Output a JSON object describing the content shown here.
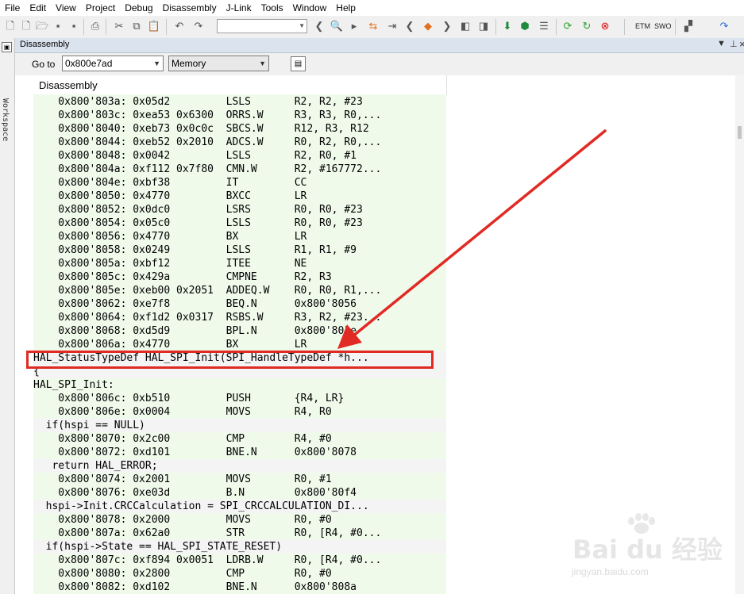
{
  "menu": [
    "File",
    "Edit",
    "View",
    "Project",
    "Debug",
    "Disassembly",
    "J-Link",
    "Tools",
    "Window",
    "Help"
  ],
  "toolbar": {
    "etm_label": "ETM",
    "swo_label": "SWO"
  },
  "workspace_tab": "Workspace",
  "pane": {
    "title": "Disassembly",
    "pin_glyph": "▼",
    "dock_glyph": "⊥",
    "close_glyph": "×"
  },
  "goto": {
    "label": "Go to",
    "address": "0x800e7ad",
    "memory": "Memory"
  },
  "listing": {
    "column_header": "Disassembly",
    "lines": [
      {
        "text": "    0x800'803a: 0x05d2         LSLS       R2, R2, #23",
        "kind": "asm"
      },
      {
        "text": "    0x800'803c: 0xea53 0x6300  ORRS.W     R3, R3, R0,...",
        "kind": "asm"
      },
      {
        "text": "    0x800'8040: 0xeb73 0x0c0c  SBCS.W     R12, R3, R12",
        "kind": "asm"
      },
      {
        "text": "    0x800'8044: 0xeb52 0x2010  ADCS.W     R0, R2, R0,...",
        "kind": "asm"
      },
      {
        "text": "    0x800'8048: 0x0042         LSLS       R2, R0, #1",
        "kind": "asm"
      },
      {
        "text": "    0x800'804a: 0xf112 0x7f80  CMN.W      R2, #167772...",
        "kind": "asm"
      },
      {
        "text": "    0x800'804e: 0xbf38         IT         CC",
        "kind": "asm"
      },
      {
        "text": "    0x800'8050: 0x4770         BXCC       LR",
        "kind": "asm"
      },
      {
        "text": "    0x800'8052: 0x0dc0         LSRS       R0, R0, #23",
        "kind": "asm"
      },
      {
        "text": "    0x800'8054: 0x05c0         LSLS       R0, R0, #23",
        "kind": "asm"
      },
      {
        "text": "    0x800'8056: 0x4770         BX         LR",
        "kind": "asm"
      },
      {
        "text": "    0x800'8058: 0x0249         LSLS       R1, R1, #9",
        "kind": "asm"
      },
      {
        "text": "    0x800'805a: 0xbf12         ITEE       NE",
        "kind": "asm"
      },
      {
        "text": "    0x800'805c: 0x429a         CMPNE      R2, R3",
        "kind": "asm"
      },
      {
        "text": "    0x800'805e: 0xeb00 0x2051  ADDEQ.W    R0, R0, R1,...",
        "kind": "asm"
      },
      {
        "text": "    0x800'8062: 0xe7f8         BEQ.N      0x800'8056",
        "kind": "asm"
      },
      {
        "text": "    0x800'8064: 0xf1d2 0x0317  RSBS.W     R3, R2, #23...",
        "kind": "asm"
      },
      {
        "text": "    0x800'8068: 0xd5d9         BPL.N      0x800'801e",
        "kind": "asm"
      },
      {
        "text": "    0x800'806a: 0x4770         BX         LR",
        "kind": "asm"
      },
      {
        "text": "HAL_StatusTypeDef HAL_SPI_Init(SPI_HandleTypeDef *h...",
        "kind": "src"
      },
      {
        "text": "{",
        "kind": "src"
      },
      {
        "text": "HAL_SPI_Init:",
        "kind": "label"
      },
      {
        "text": "    0x800'806c: 0xb510         PUSH       {R4, LR}",
        "kind": "asm"
      },
      {
        "text": "    0x800'806e: 0x0004         MOVS       R4, R0",
        "kind": "asm"
      },
      {
        "text": "  if(hspi == NULL)",
        "kind": "src"
      },
      {
        "text": "    0x800'8070: 0x2c00         CMP        R4, #0",
        "kind": "asm"
      },
      {
        "text": "    0x800'8072: 0xd101         BNE.N      0x800'8078",
        "kind": "asm"
      },
      {
        "text": "   return HAL_ERROR;",
        "kind": "src"
      },
      {
        "text": "    0x800'8074: 0x2001         MOVS       R0, #1",
        "kind": "asm"
      },
      {
        "text": "    0x800'8076: 0xe03d         B.N        0x800'80f4",
        "kind": "asm"
      },
      {
        "text": "  hspi->Init.CRCCalculation = SPI_CRCCALCULATION_DI...",
        "kind": "src"
      },
      {
        "text": "    0x800'8078: 0x2000         MOVS       R0, #0",
        "kind": "asm"
      },
      {
        "text": "    0x800'807a: 0x62a0         STR        R0, [R4, #0...",
        "kind": "asm"
      },
      {
        "text": "  if(hspi->State == HAL_SPI_STATE_RESET)",
        "kind": "src"
      },
      {
        "text": "    0x800'807c: 0xf894 0x0051  LDRB.W     R0, [R4, #0...",
        "kind": "asm"
      },
      {
        "text": "    0x800'8080: 0x2800         CMP        R0, #0",
        "kind": "asm"
      },
      {
        "text": "    0x800'8082: 0xd102         BNE.N      0x800'808a",
        "kind": "asm"
      }
    ]
  },
  "annotation": {
    "color": "#e12a24"
  },
  "watermark": {
    "logo": "Bai du 经验",
    "url": "jingyan.baidu.com"
  }
}
